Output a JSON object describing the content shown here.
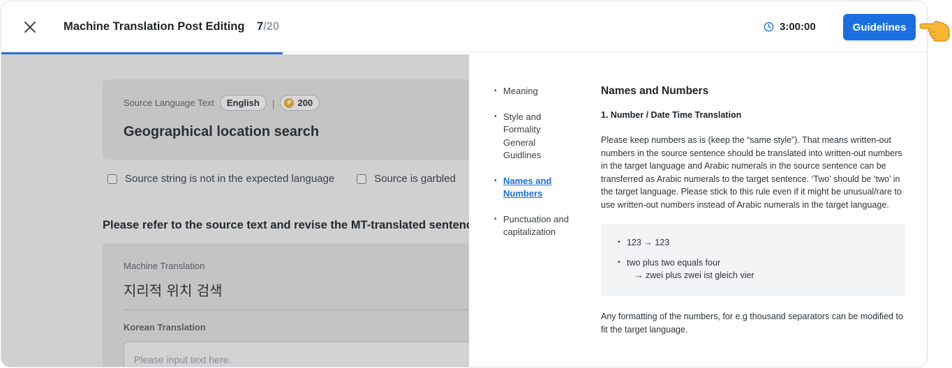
{
  "header": {
    "title": "Machine Translation Post Editing",
    "progress_current": "7",
    "progress_separator": "/",
    "progress_total": "20",
    "progress_fraction": 0.35,
    "timer": "3:00:00",
    "guidelines_label": "Guidelines",
    "accent_color": "#1a6fe0"
  },
  "source": {
    "label": "Source Language Text",
    "language": "English",
    "points": "200",
    "text": "Geographical location search"
  },
  "checks": {
    "not_expected_language": "Source string is not in the expected language",
    "garbled": "Source is garbled"
  },
  "instruction": "Please refer to the source text and revise the MT-translated sentence",
  "translation": {
    "mt_label": "Machine Translation",
    "mt_text": "지리적 위치 검색",
    "ko_label": "Korean Translation",
    "ko_placeholder": "Please input text here."
  },
  "guidelines": {
    "toc": [
      {
        "label": "Meaning"
      },
      {
        "label": "Style and Formality General Guidlines"
      },
      {
        "label": "Names and Numbers"
      },
      {
        "label": "Punctuation and capitalization"
      }
    ],
    "heading": "Names and Numbers",
    "subheading": "1. Number / Date Time Translation",
    "paragraph": "Please keep numbers as is (keep the “same style”). That means written-out numbers in the source sentence should be translated into written-out numbers in the target language and Arabic numerals in the source sentence can be transferred as Arabic numerals to the target sentence. ‘Two’ should be ‘two’ in the target language. Please stick to this rule even if it might be unusual/rare to use written-out numbers instead of Arabic numerals in the target language.",
    "examples": {
      "ex1": "123 → 123",
      "ex2": "two plus two equals four",
      "ex2_sub": "→  zwei plus zwei ist gleich vier"
    },
    "after_paragraph": "Any formatting of the numbers, for e.g thousand separators can be modified to fit the target language."
  }
}
